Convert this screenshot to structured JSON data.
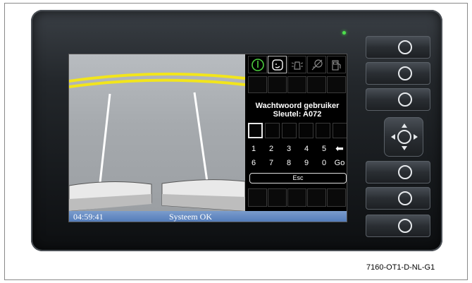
{
  "status": {
    "time": "04:59:41",
    "message": "Systeem OK"
  },
  "password_screen": {
    "title_line1": "Wachtwoord gebruiker",
    "title_line2": "Sleutel: A072"
  },
  "keypad": {
    "row1": [
      "1",
      "2",
      "3",
      "4",
      "5"
    ],
    "row2": [
      "6",
      "7",
      "8",
      "9",
      "0"
    ],
    "backspace_glyph": "⬅",
    "go_label": "Go",
    "esc_label": "Esc"
  },
  "icons": [
    "power-icon",
    "driver-face-icon",
    "hazard-lights-icon",
    "lamp-failure-icon",
    "fuel-pump-icon"
  ],
  "colors": {
    "status_bar": "#5a82bf",
    "power_icon": "#4ccd3e",
    "led": "#4de04d",
    "lane_yellow": "#f2e51c"
  },
  "caption": "7160-OT1-D-NL-G1"
}
